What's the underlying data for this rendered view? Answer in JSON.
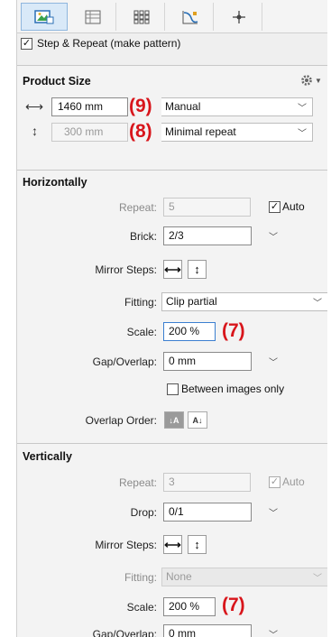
{
  "header": {
    "step_repeat_label": "Step & Repeat (make pattern)",
    "step_repeat_checked": true
  },
  "product_size": {
    "title": "Product Size",
    "width": {
      "value": "1460 mm",
      "mode": "Manual",
      "annotation": "(9)"
    },
    "height": {
      "value": "300 mm",
      "mode": "Minimal repeat",
      "annotation": "(8)"
    }
  },
  "horizontally": {
    "title": "Horizontally",
    "repeat_label": "Repeat:",
    "repeat_value": "5",
    "auto_label": "Auto",
    "auto_checked": true,
    "brick_label": "Brick:",
    "brick_value": "2/3",
    "mirror_label": "Mirror Steps:",
    "fitting_label": "Fitting:",
    "fitting_value": "Clip partial",
    "scale_label": "Scale:",
    "scale_value": "200 %",
    "scale_annotation": "(7)",
    "gap_label": "Gap/Overlap:",
    "gap_value": "0 mm",
    "between_label": "Between images only",
    "between_checked": false,
    "overlap_label": "Overlap Order:"
  },
  "vertically": {
    "title": "Vertically",
    "repeat_label": "Repeat:",
    "repeat_value": "3",
    "auto_label": "Auto",
    "auto_checked": true,
    "drop_label": "Drop:",
    "drop_value": "0/1",
    "mirror_label": "Mirror Steps:",
    "fitting_label": "Fitting:",
    "fitting_value": "None",
    "scale_label": "Scale:",
    "scale_value": "200 %",
    "scale_annotation": "(7)",
    "gap_label": "Gap/Overlap:",
    "gap_value": "0 mm"
  },
  "icons": {
    "tabs": [
      "image-layout-icon",
      "grid-layout-icon",
      "tile-grid-icon",
      "curve-edit-icon",
      "crosshair-icon"
    ],
    "settings": "gear-icon",
    "horizontal_arrow": "horizontal-arrow-icon",
    "vertical_arrow": "vertical-arrow-icon"
  },
  "colors": {
    "annotation": "#d8151b",
    "active_tab": "#d9e9f8",
    "panel_bg": "#efefef"
  }
}
